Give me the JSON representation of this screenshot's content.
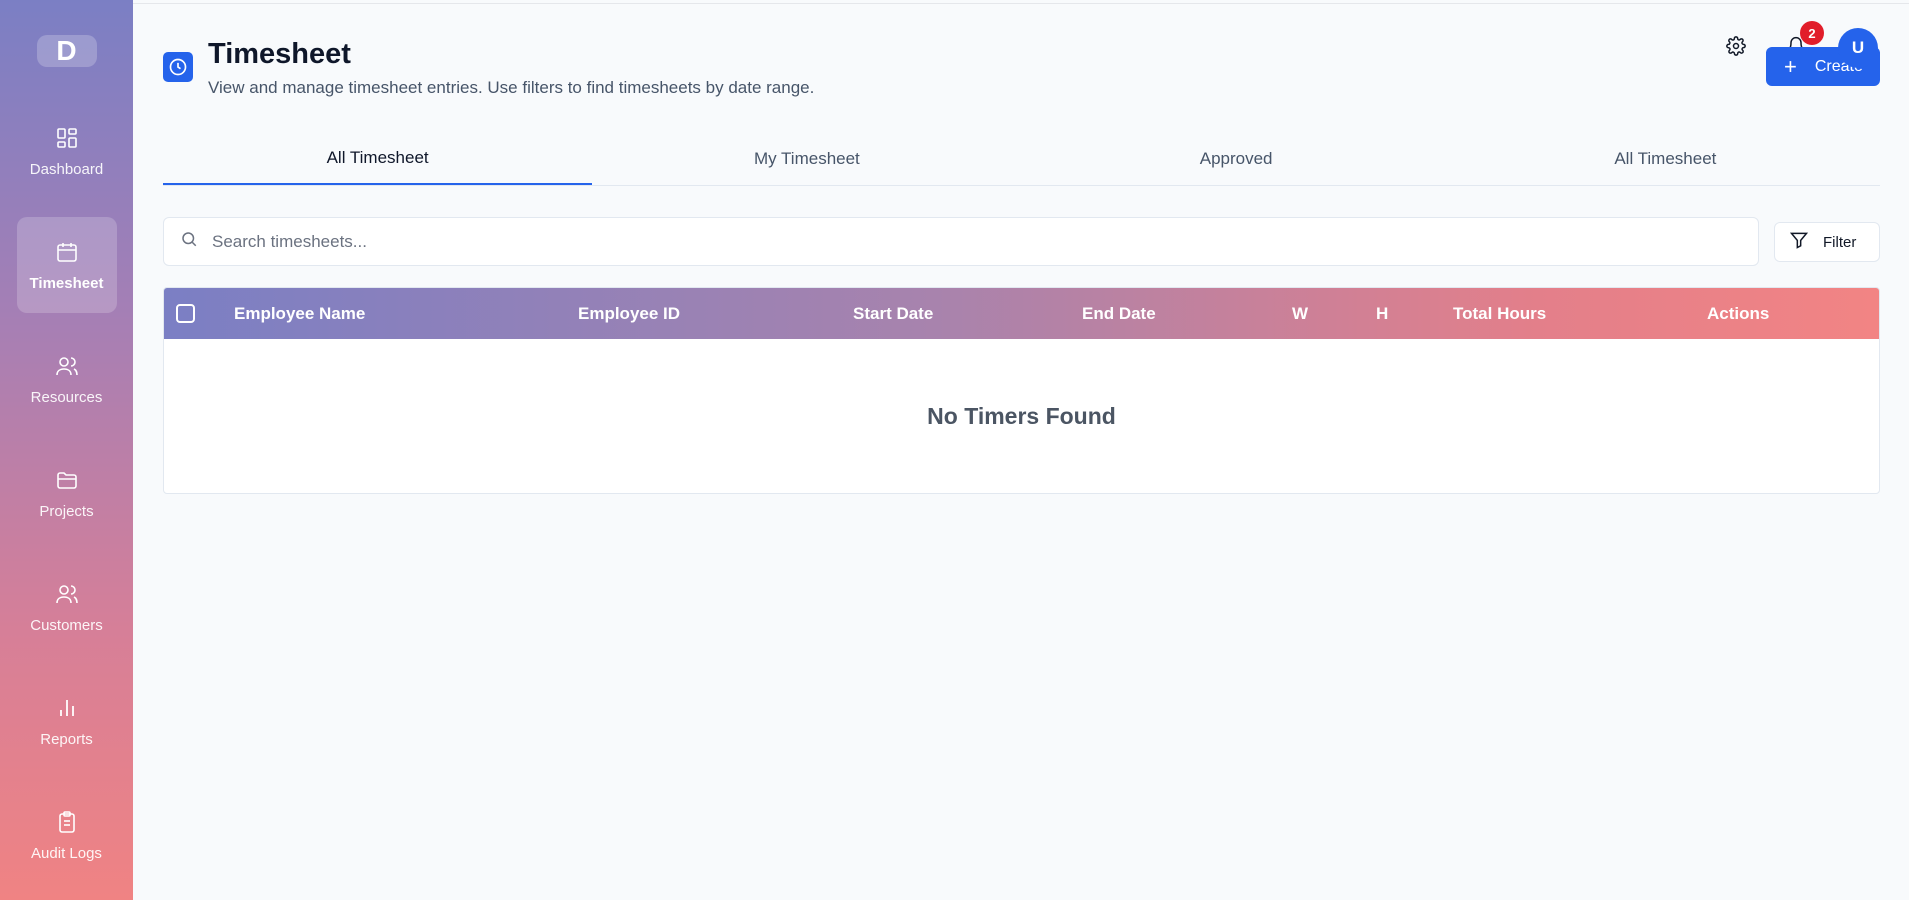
{
  "sidebar": {
    "logo": "D",
    "items": [
      {
        "label": "Dashboard",
        "icon": "dashboard-icon"
      },
      {
        "label": "Timesheet",
        "icon": "calendar-icon"
      },
      {
        "label": "Resources",
        "icon": "users-icon"
      },
      {
        "label": "Projects",
        "icon": "folder-icon"
      },
      {
        "label": "Customers",
        "icon": "users-icon"
      },
      {
        "label": "Reports",
        "icon": "bar-chart-icon"
      },
      {
        "label": "Audit Logs",
        "icon": "clipboard-icon"
      }
    ],
    "active": "Timesheet"
  },
  "header": {
    "title": "Timesheet",
    "subtitle": "View and manage timesheet entries. Use filters to find timesheets by date range.",
    "notification_count": "2",
    "avatar_initial": "U",
    "create_label": "Create"
  },
  "tabs": [
    "All Timesheet",
    "My Timesheet",
    "Approved",
    "All Timesheet"
  ],
  "search": {
    "placeholder": "Search timesheets..."
  },
  "filter_label": "Filter",
  "table": {
    "columns": [
      "Employee Name",
      "Employee ID",
      "Start Date",
      "End Date",
      "W",
      "H",
      "Total Hours",
      "Actions"
    ],
    "empty_message": "No Timers Found"
  },
  "colors": {
    "accent": "#2563eb",
    "sidebar_top": "#7b7fc4",
    "sidebar_bottom": "#f08383",
    "badge": "#e11d2a"
  }
}
